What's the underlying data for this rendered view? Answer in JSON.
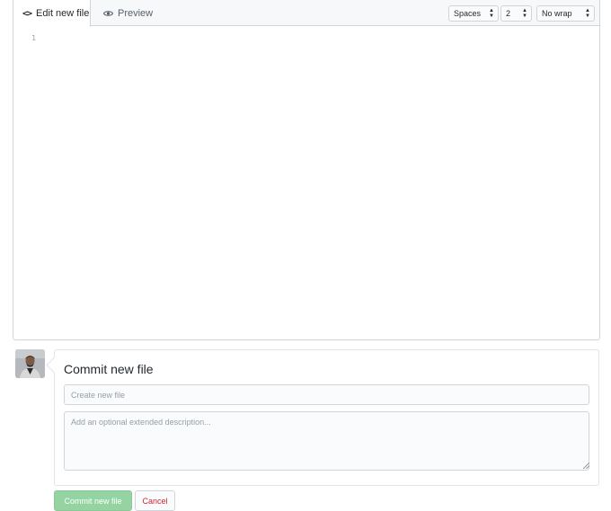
{
  "editor": {
    "tabs": [
      {
        "label": "Edit new file",
        "icon": "code-icon",
        "active": true
      },
      {
        "label": "Preview",
        "icon": "eye-icon",
        "active": false
      }
    ],
    "indent_mode": "Spaces",
    "indent_size": "2",
    "wrap_mode": "No wrap",
    "line_numbers": [
      "1"
    ]
  },
  "commit": {
    "title": "Commit new file",
    "summary_placeholder": "Create new file",
    "description_placeholder": "Add an optional extended description...",
    "commit_button": "Commit new file",
    "cancel_button": "Cancel"
  },
  "colors": {
    "commit_button_bg": "#94d3a2",
    "cancel_text": "#cb2431",
    "border": "#d1d5da",
    "header_bg": "#f6f8fa"
  }
}
